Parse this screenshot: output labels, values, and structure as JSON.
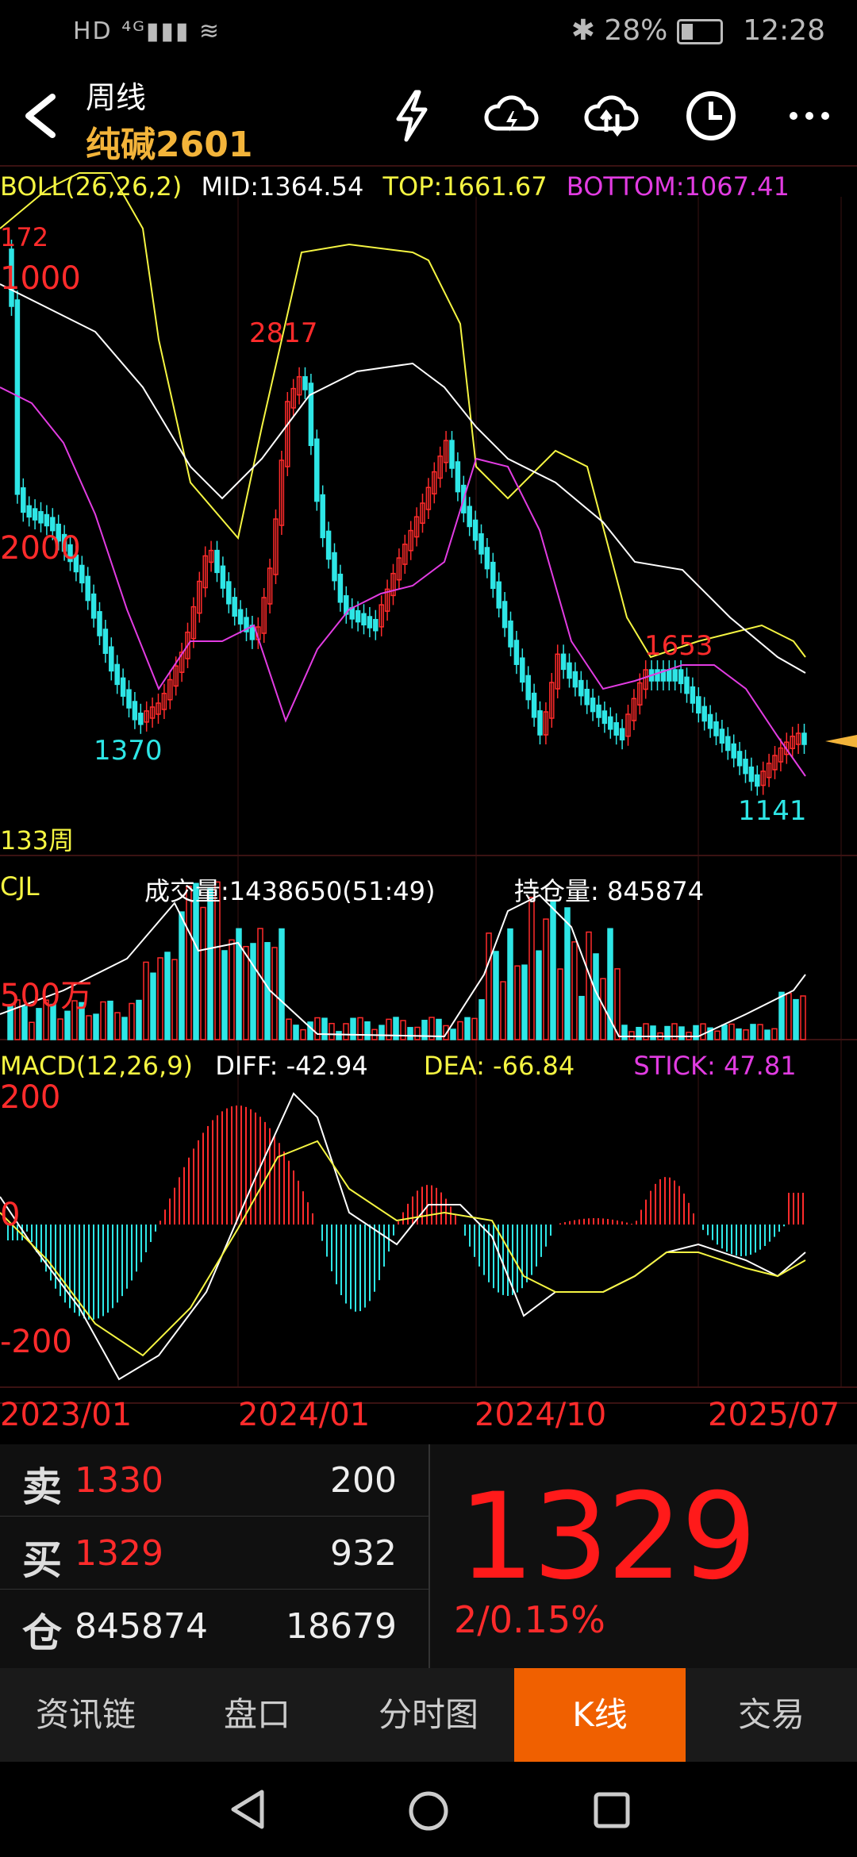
{
  "status_bar": {
    "left_text": "HD ⁴ᴳ▮▮▮ ≋",
    "battery": "28%",
    "time": "12:28"
  },
  "header": {
    "title_period": "周线",
    "title_symbol": "纯碱2601"
  },
  "boll": {
    "label": "BOLL(26,26,2)",
    "mid": "MID:1364.54",
    "top": "TOP:1661.67",
    "bottom": "BOTTOM:1067.41"
  },
  "price_labels": {
    "high1": "172",
    "grid_top": "1000",
    "high2": "2817",
    "grid_mid": "2000",
    "low1": "1370",
    "mid_label": "1653",
    "low2": "1141",
    "period_count": "133周"
  },
  "volume": {
    "label": "CJL",
    "volume": "成交量:1438650(51:49)",
    "open_interest": "持仓量: 845874",
    "scale": "500万"
  },
  "macd": {
    "label": "MACD(12,26,9)",
    "diff": "DIFF: -42.94",
    "dea": "DEA: -66.84",
    "stick": "STICK: 47.81",
    "top": "200",
    "zero": "0",
    "bottom": "-200"
  },
  "x_axis": [
    "2023/01",
    "2024/01",
    "2024/10",
    "2025/07"
  ],
  "quote": {
    "sell_label": "卖",
    "sell_price": "1330",
    "sell_qty": "200",
    "buy_label": "买",
    "buy_price": "1329",
    "buy_qty": "932",
    "oi_label": "仓",
    "oi_value": "845874",
    "oi_change": "18679",
    "last_price": "1329",
    "change": "2/0.15%"
  },
  "tabs": [
    {
      "label": "资讯链"
    },
    {
      "label": "盘口"
    },
    {
      "label": "分时图"
    },
    {
      "label": "K线"
    },
    {
      "label": "交易"
    }
  ],
  "colors": {
    "up": "#ff2b2b",
    "down": "#2ee6e6",
    "yellow": "#f5f542",
    "magenta": "#e23ce2",
    "accent": "#f06000",
    "symbol": "#f3b43a"
  }
}
